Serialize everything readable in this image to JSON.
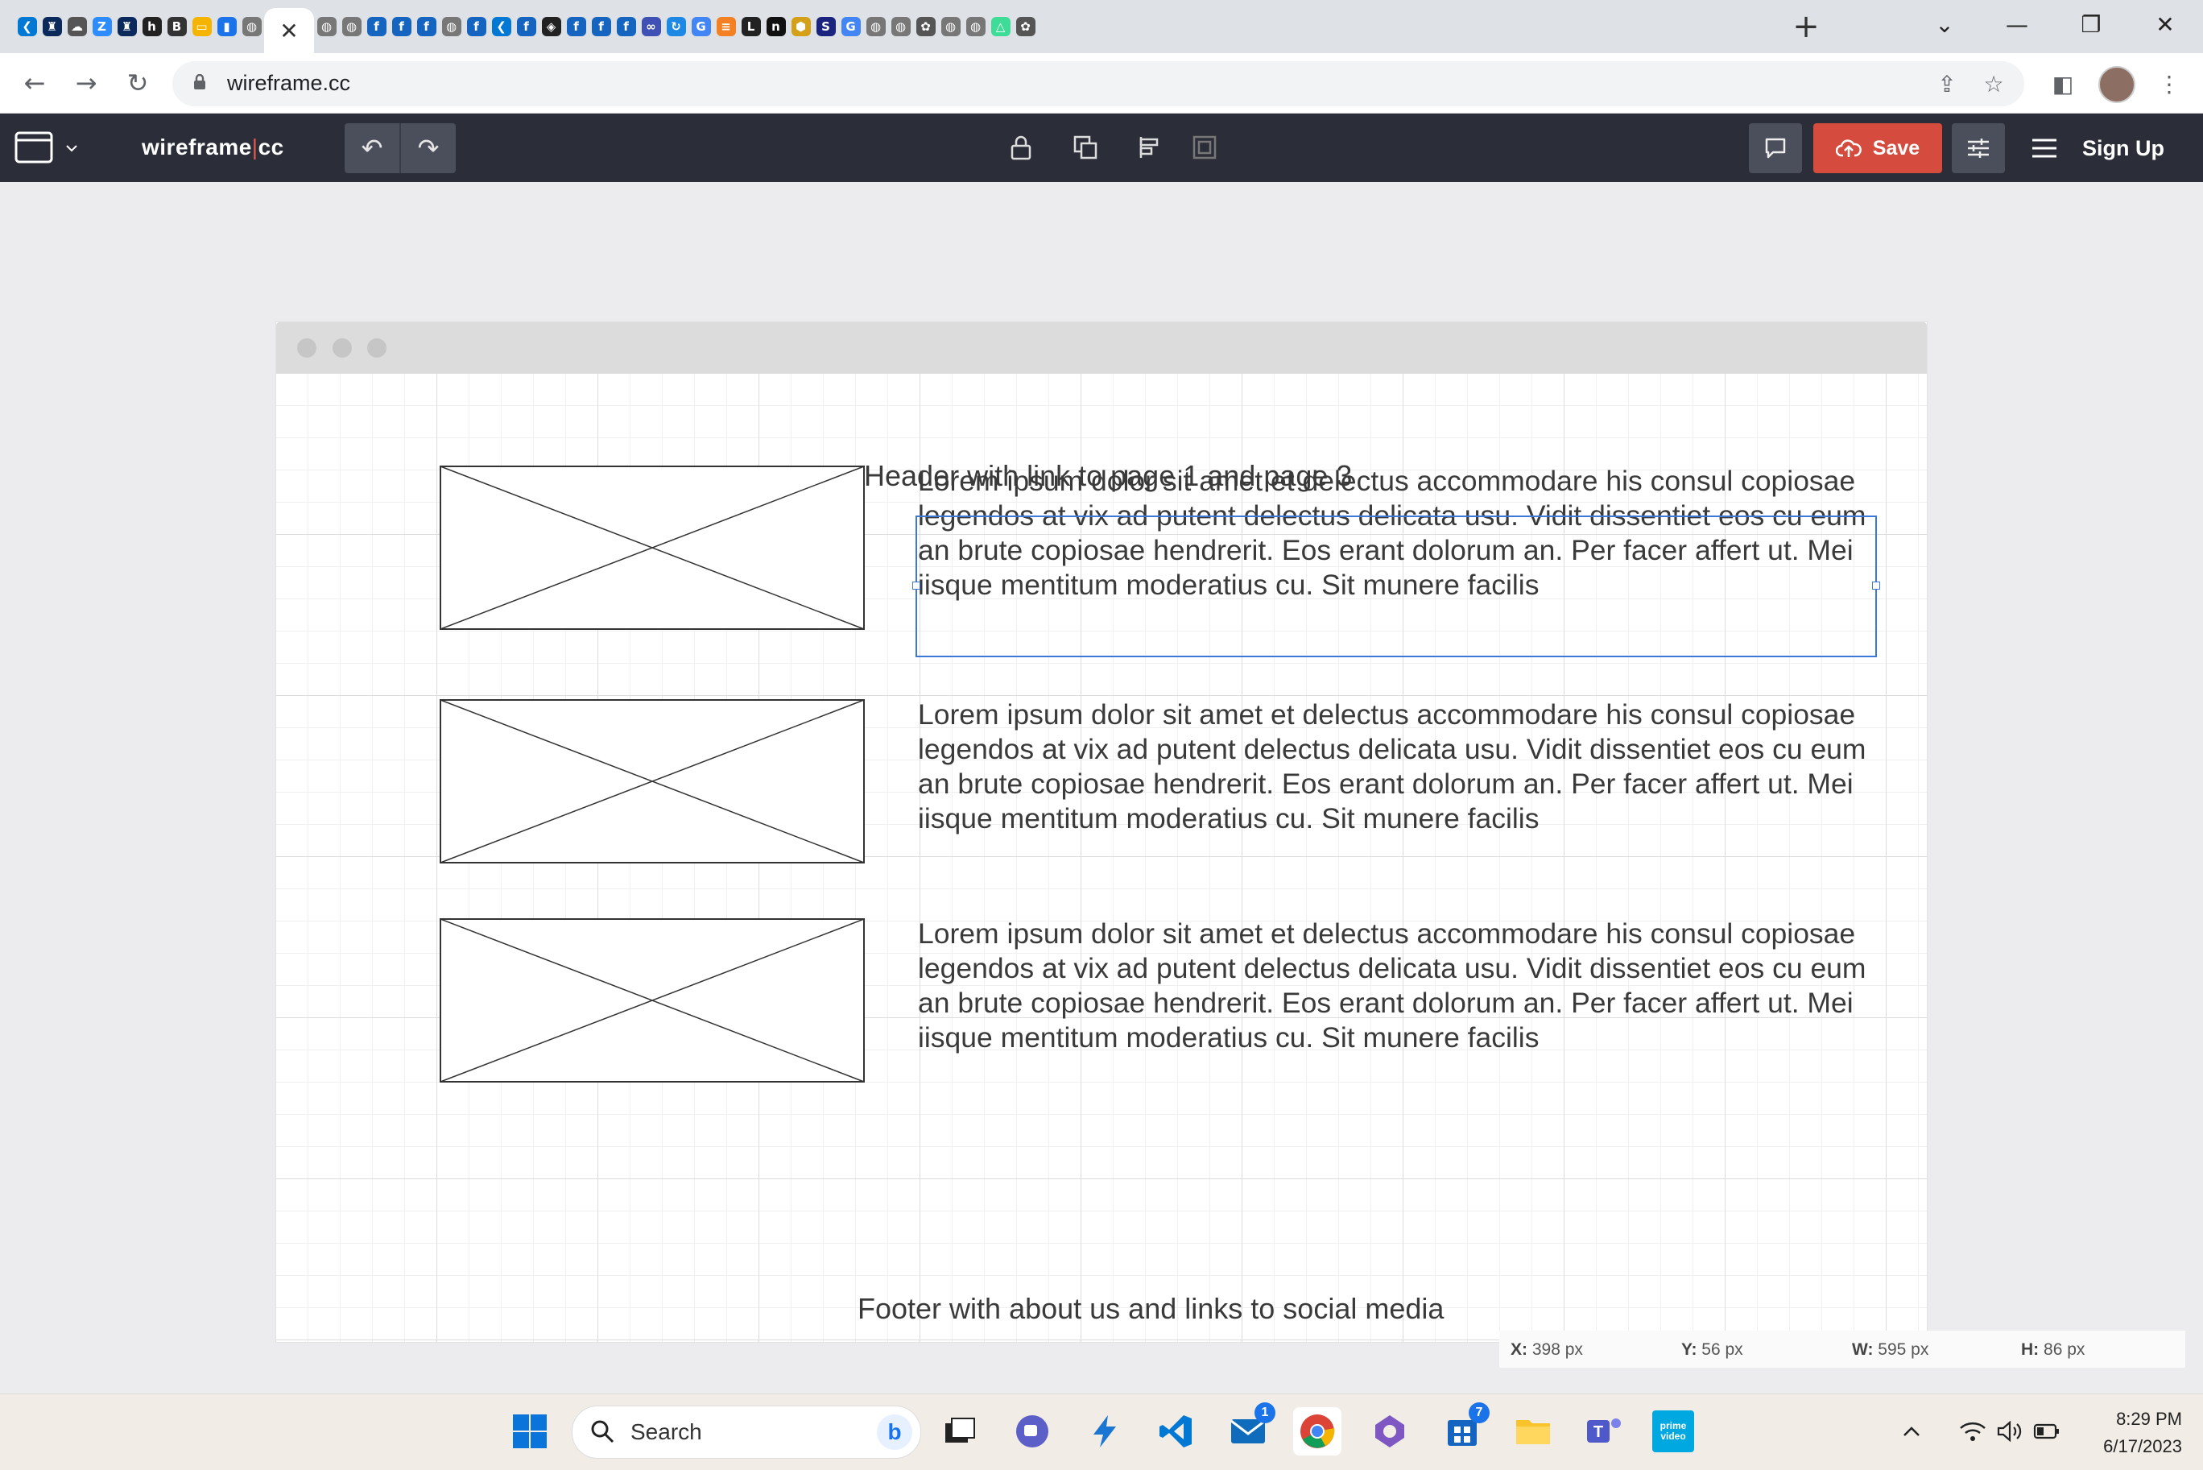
{
  "browser": {
    "tab_icons": [
      {
        "name": "vscode-tab-icon",
        "color": "#0078d4",
        "glyph": "❮"
      },
      {
        "name": "byu-tab-icon",
        "color": "#0b2a5b",
        "glyph": "♜"
      },
      {
        "name": "cloud-tab-icon",
        "color": "#555555",
        "glyph": "☁"
      },
      {
        "name": "zoom-tab-icon",
        "color": "#2d8cff",
        "glyph": "Z"
      },
      {
        "name": "byu-tab-icon-2",
        "color": "#0b2a5b",
        "glyph": "♜"
      },
      {
        "name": "hu-tab-icon",
        "color": "#222222",
        "glyph": "h"
      },
      {
        "name": "byu-idaho-tab-icon",
        "color": "#333333",
        "glyph": "B"
      },
      {
        "name": "slides-tab-icon",
        "color": "#f4b400",
        "glyph": "▭"
      },
      {
        "name": "chart-tab-icon",
        "color": "#1a73e8",
        "glyph": "▮"
      },
      {
        "name": "globe-tab-icon",
        "color": "#777777",
        "glyph": "◍"
      },
      {
        "name": "globe-tab-icon-2",
        "color": "#777777",
        "glyph": "◍"
      },
      {
        "name": "globe-tab-icon-3",
        "color": "#777777",
        "glyph": "◍"
      },
      {
        "name": "figma-f-tab-icon",
        "color": "#1565c0",
        "glyph": "f"
      },
      {
        "name": "figma-f-tab-icon-2",
        "color": "#1565c0",
        "glyph": "f"
      },
      {
        "name": "figma-f-tab-icon-3",
        "color": "#1565c0",
        "glyph": "f"
      },
      {
        "name": "globe-tab-icon-4",
        "color": "#777777",
        "glyph": "◍"
      },
      {
        "name": "figma-f-tab-icon-4",
        "color": "#1565c0",
        "glyph": "f"
      },
      {
        "name": "vscode-tab-icon-2",
        "color": "#0078d4",
        "glyph": "❮"
      },
      {
        "name": "figma-f-tab-icon-5",
        "color": "#1565c0",
        "glyph": "f"
      },
      {
        "name": "cube-tab-icon",
        "color": "#222222",
        "glyph": "◈"
      },
      {
        "name": "figma-f-tab-icon-6",
        "color": "#1565c0",
        "glyph": "f"
      },
      {
        "name": "figma-f-tab-icon-7",
        "color": "#1565c0",
        "glyph": "f"
      },
      {
        "name": "figma-f-tab-icon-8",
        "color": "#1565c0",
        "glyph": "f"
      },
      {
        "name": "infinity-tab-icon",
        "color": "#3f51b5",
        "glyph": "∞"
      },
      {
        "name": "sync-tab-icon",
        "color": "#1e88e5",
        "glyph": "↻"
      },
      {
        "name": "google-tab-icon",
        "color": "#4285f4",
        "glyph": "G"
      },
      {
        "name": "stackoverflow-tab-icon",
        "color": "#f48024",
        "glyph": "≡"
      },
      {
        "name": "l-tab-icon",
        "color": "#222222",
        "glyph": "L"
      },
      {
        "name": "n-tab-icon",
        "color": "#111111",
        "glyph": "n"
      },
      {
        "name": "hex-tab-icon",
        "color": "#d4a017",
        "glyph": "⬢"
      },
      {
        "name": "s-tab-icon",
        "color": "#1a237e",
        "glyph": "S"
      },
      {
        "name": "google-tab-icon-2",
        "color": "#4285f4",
        "glyph": "G"
      },
      {
        "name": "globe-tab-icon-5",
        "color": "#777777",
        "glyph": "◍"
      },
      {
        "name": "globe-tab-icon-6",
        "color": "#777777",
        "glyph": "◍"
      },
      {
        "name": "chatgpt-tab-icon",
        "color": "#555555",
        "glyph": "✿"
      },
      {
        "name": "globe-tab-icon-7",
        "color": "#777777",
        "glyph": "◍"
      },
      {
        "name": "globe-tab-icon-8",
        "color": "#777777",
        "glyph": "◍"
      },
      {
        "name": "drive-tab-icon",
        "color": "#3ddc97",
        "glyph": "△"
      },
      {
        "name": "chatgpt-tab-icon-2",
        "color": "#555555",
        "glyph": "✿"
      }
    ],
    "active_tab_close": "✕",
    "new_tab": "+",
    "url": "wireframe.cc"
  },
  "app": {
    "logo_left": "wireframe",
    "logo_sep": "|",
    "logo_right": "cc",
    "save_label": "Save",
    "signup_label": "Sign Up",
    "accent_color": "#d54c3e",
    "header_bg": "#2b2e38"
  },
  "wireframe": {
    "header_text": "Header with link to page 1 and page 3",
    "footer_text": "Footer with about us and links to social media",
    "paragraphs": [
      "Lorem ipsum dolor sit amet et delectus accommodare his consul copiosae legendos at vix ad putent delectus delicata usu. Vidit dissentiet eos cu eum an brute copiosae hendrerit. Eos erant dolorum an. Per facer affert ut. Mei iisque mentitum moderatius cu. Sit munere facilis",
      "Lorem ipsum dolor sit amet et delectus accommodare his consul copiosae legendos at vix ad putent delectus delicata usu. Vidit dissentiet eos cu eum an brute copiosae hendrerit. Eos erant dolorum an. Per facer affert ut. Mei iisque mentitum moderatius cu. Sit munere facilis",
      "Lorem ipsum dolor sit amet et delectus accommodare his consul copiosae legendos at vix ad putent delectus delicata usu. Vidit dissentiet eos cu eum an brute copiosae hendrerit. Eos erant dolorum an. Per facer affert ut. Mei iisque mentitum moderatius cu. Sit munere facilis"
    ]
  },
  "status": {
    "x_label": "X:",
    "x_value": "398 px",
    "y_label": "Y:",
    "y_value": "56 px",
    "w_label": "W:",
    "w_value": "595 px",
    "h_label": "H:",
    "h_value": "86 px"
  },
  "taskbar": {
    "search_placeholder": "Search",
    "mail_badge": "1",
    "store_badge": "7",
    "prime_label": "prime video",
    "time": "8:29 PM",
    "date": "6/17/2023"
  }
}
